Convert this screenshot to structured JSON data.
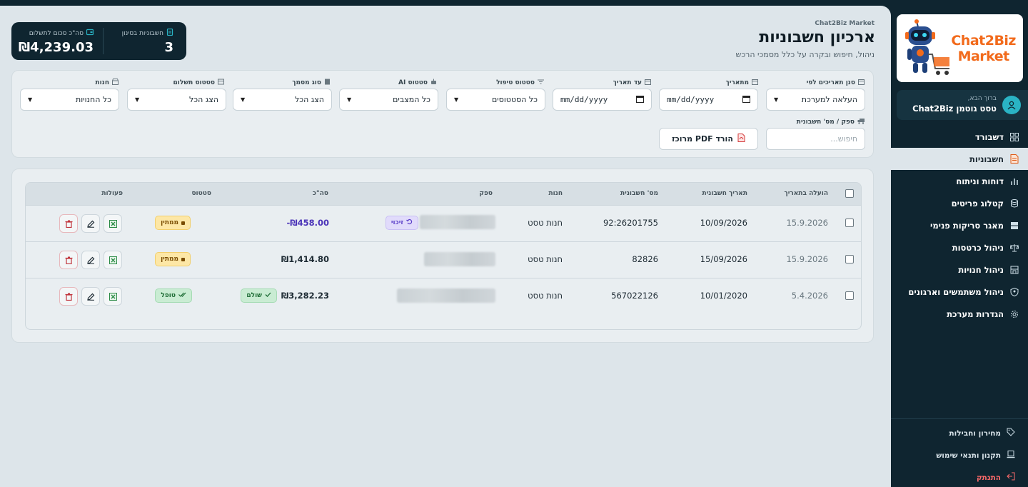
{
  "brand": {
    "name": "Chat2Biz Market",
    "logo_line1": "Chat2Biz",
    "logo_line2": "Market"
  },
  "user": {
    "greeting": "ברוך הבא,",
    "name": "טסט גוטמן Chat2Biz"
  },
  "nav": {
    "items": [
      {
        "label": "דשבורד",
        "icon": "grid-icon"
      },
      {
        "label": "חשבוניות",
        "icon": "document-icon",
        "active": true
      },
      {
        "label": "דוחות וניתוח",
        "icon": "bar-chart-icon"
      },
      {
        "label": "קטלוג פריטים",
        "icon": "database-icon"
      },
      {
        "label": "מאגר סריקות פנימי",
        "icon": "server-icon"
      },
      {
        "label": "ניהול כרטסות",
        "icon": "scale-icon"
      },
      {
        "label": "ניהול חנויות",
        "icon": "store-icon"
      },
      {
        "label": "ניהול משתמשים וארגונים",
        "icon": "shield-user-icon"
      },
      {
        "label": "הגדרות מערכת",
        "icon": "gear-icon"
      }
    ],
    "bottom": [
      {
        "label": "מחירון וחבילות",
        "icon": "tag-icon"
      },
      {
        "label": "תקנון ותנאי שימוש",
        "icon": "laptop-icon"
      },
      {
        "label": "התנתק",
        "icon": "logout-icon"
      }
    ]
  },
  "header": {
    "brand_small": "Chat2Biz Market",
    "title": "ארכיון חשבוניות",
    "subtitle": "ניהול, חיפוש ובקרה על כלל מסמכי הרכש"
  },
  "stats": {
    "filtered_label": "חשבוניות בסינון",
    "filtered_value": "3",
    "total_label": "סה\"כ סכום לתשלום",
    "total_value": "₪4,239.03"
  },
  "filters": {
    "sort_dates": {
      "label": "סנן תאריכים לפי",
      "value": "העלאה למערכת"
    },
    "from_date": {
      "label": "מתאריך",
      "value": "mm/dd/yyyy"
    },
    "to_date": {
      "label": "עד תאריך",
      "value": "mm/dd/yyyy"
    },
    "handling_status": {
      "label": "סטטוס טיפול",
      "value": "כל הסטטוסים"
    },
    "ai_status": {
      "label": "סטטוס AI",
      "value": "כל המצבים"
    },
    "doc_type": {
      "label": "סוג מסמך",
      "value": "הצג הכל"
    },
    "payment_status": {
      "label": "סטטוס תשלום",
      "value": "הצג הכל"
    },
    "store": {
      "label": "חנות",
      "value": "כל החנויות"
    },
    "search": {
      "label": "ספק / מס' חשבונית",
      "placeholder": "חיפוש..."
    },
    "pdf_button": "הורד PDF מרוכז"
  },
  "table": {
    "headers": {
      "uploaded": "הועלה בתאריך",
      "invoice_date": "תאריך חשבונית",
      "invoice_no": "מס' חשבונית",
      "store": "חנות",
      "supplier": "ספק",
      "total": "סה\"כ",
      "status": "סטטוס",
      "actions": "פעולות"
    },
    "rows": [
      {
        "uploaded": "15.9.2026",
        "invoice_date": "10/09/2026",
        "invoice_no": "92:26201755",
        "store": "חנות טסט",
        "supplier_tag": "זיכוי",
        "total": "-₪458.00",
        "payment": "",
        "status": "ממתין"
      },
      {
        "uploaded": "15.9.2026",
        "invoice_date": "15/09/2026",
        "invoice_no": "82826",
        "store": "חנות טסט",
        "supplier_tag": "",
        "total": "₪1,414.80",
        "payment": "",
        "status": "ממתין"
      },
      {
        "uploaded": "5.4.2026",
        "invoice_date": "10/01/2020",
        "invoice_no": "567022126",
        "store": "חנות טסט",
        "supplier_tag": "",
        "total": "₪3,282.23",
        "payment": "שולם",
        "status": "טופל"
      }
    ]
  },
  "colors": {
    "sidebar": "#0f2530",
    "accent_orange": "#f26a1b",
    "credit": "#5a3ec8",
    "pending": "#fde7a6",
    "done": "#c9ecd3"
  }
}
